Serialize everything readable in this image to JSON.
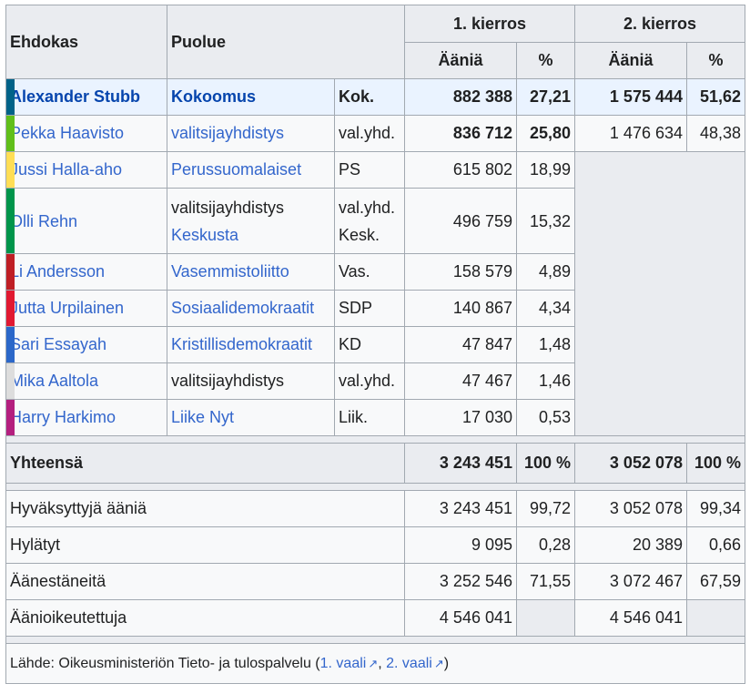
{
  "header": {
    "col_candidate": "Ehdokas",
    "col_party": "Puolue",
    "round1": "1. kierros",
    "round2": "2. kierros",
    "votes": "Ääniä",
    "percent": "%"
  },
  "candidates": [
    {
      "name": "Alexander Stubb",
      "party": "Kokoomus",
      "party2": "",
      "abbr": "Kok.",
      "abbr2": "",
      "r1_votes": "882 388",
      "r1_pct": "27,21",
      "r2_votes": "1 575 444",
      "r2_pct": "51,62",
      "color": "#006288"
    },
    {
      "name": "Pekka Haavisto",
      "party": "valitsijayhdistys",
      "party2": "",
      "abbr": "val.yhd.",
      "abbr2": "",
      "r1_votes": "836 712",
      "r1_pct": "25,80",
      "r2_votes": "1 476 634",
      "r2_pct": "48,38",
      "color": "#61bf1a"
    },
    {
      "name": "Jussi Halla-aho",
      "party": "Perussuomalaiset",
      "party2": "",
      "abbr": "PS",
      "abbr2": "",
      "r1_votes": "615 802",
      "r1_pct": "18,99",
      "color": "#ffde55"
    },
    {
      "name": "Olli Rehn",
      "party": "valitsijayhdistys",
      "party2": "Keskusta",
      "abbr": "val.yhd.",
      "abbr2": "Kesk.",
      "r1_votes": "496 759",
      "r1_pct": "15,32",
      "color": "#01954b"
    },
    {
      "name": "Li Andersson",
      "party": "Vasemmistoliitto",
      "party2": "",
      "abbr": "Vas.",
      "abbr2": "",
      "r1_votes": "158 579",
      "r1_pct": "4,89",
      "color": "#bf1e24"
    },
    {
      "name": "Jutta Urpilainen",
      "party": "Sosiaalidemokraatit",
      "party2": "",
      "abbr": "SDP",
      "abbr2": "",
      "r1_votes": "140 867",
      "r1_pct": "4,34",
      "color": "#e11931"
    },
    {
      "name": "Sari Essayah",
      "party": "Kristillisdemokraatit",
      "party2": "",
      "abbr": "KD",
      "abbr2": "",
      "r1_votes": "47 847",
      "r1_pct": "1,48",
      "color": "#2b67c9"
    },
    {
      "name": "Mika Aaltola",
      "party": "valitsijayhdistys",
      "party2": "",
      "abbr": "val.yhd.",
      "abbr2": "",
      "r1_votes": "47 467",
      "r1_pct": "1,46",
      "color": "#dddddd"
    },
    {
      "name": "Harry Harkimo",
      "party": "Liike Nyt",
      "party2": "",
      "abbr": "Liik.",
      "abbr2": "",
      "r1_votes": "17 030",
      "r1_pct": "0,53",
      "color": "#b41f7e"
    }
  ],
  "total": {
    "label": "Yhteensä",
    "r1_votes": "3 243 451",
    "r1_pct": "100 %",
    "r2_votes": "3 052 078",
    "r2_pct": "100 %"
  },
  "stats": [
    {
      "label": "Hyväksyttyjä ääniä",
      "r1_votes": "3 243 451",
      "r1_pct": "99,72",
      "r2_votes": "3 052 078",
      "r2_pct": "99,34"
    },
    {
      "label": "Hylätyt",
      "r1_votes": "9 095",
      "r1_pct": "0,28",
      "r2_votes": "20 389",
      "r2_pct": "0,66"
    },
    {
      "label": "Äänestäneitä",
      "r1_votes": "3 252 546",
      "r1_pct": "71,55",
      "r2_votes": "3 072 467",
      "r2_pct": "67,59"
    },
    {
      "label": "Äänioikeutettuja",
      "r1_votes": "4 546 041",
      "r1_pct": "",
      "r2_votes": "4 546 041",
      "r2_pct": ""
    }
  ],
  "source": {
    "prefix": "Lähde: Oikeusministeriön Tieto- ja tulospalvelu (",
    "link1": "1. vaali",
    "sep": ", ",
    "link2": "2. vaali",
    "suffix": ")"
  }
}
